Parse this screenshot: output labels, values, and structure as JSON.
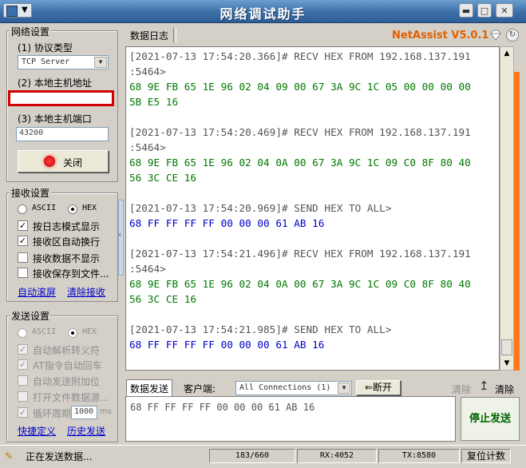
{
  "window": {
    "title": "网络调试助手",
    "brand": "NetAssist V5.0.1",
    "brand_color": "#e06000"
  },
  "net": {
    "group_title": "网络设置",
    "protocol_label": "(1) 协议类型",
    "protocol_value": "TCP Server",
    "host_label": "(2) 本地主机地址",
    "host_value": "",
    "port_label": "(3) 本地主机端口",
    "port_value": "43200",
    "close_button": "关闭"
  },
  "recv": {
    "group_title": "接收设置",
    "ascii": "ASCII",
    "hex": "HEX",
    "opt1": "按日志模式显示",
    "opt2": "接收区自动换行",
    "opt3": "接收数据不显示",
    "opt4": "接收保存到文件...",
    "auto_scroll": "自动滚屏",
    "clear_recv": "清除接收"
  },
  "send": {
    "group_title": "发送设置",
    "ascii": "ASCII",
    "hex": "HEX",
    "opt1": "自动解析转义符",
    "opt2": "AT指令自动回车",
    "opt3": "自动发送附加位",
    "opt4": "打开文件数据源...",
    "opt5_prefix": "循环周期",
    "period_value": "1000",
    "period_unit": "ms",
    "shortcut": "快捷定义",
    "history": "历史发送"
  },
  "log": {
    "tab": "数据日志",
    "lines": [
      {
        "cls": "hdr",
        "text": "[2021-07-13 17:54:20.366]# RECV HEX FROM 192.168.137.191"
      },
      {
        "cls": "hdr",
        "text": ":5464>"
      },
      {
        "cls": "recv",
        "text": "68 9E FB 65 1E 96 02 04 09 00 67 3A 9C 1C 05 00 00 00 00"
      },
      {
        "cls": "recv",
        "text": "5B E5 16"
      },
      {
        "cls": "hdr",
        "text": " "
      },
      {
        "cls": "hdr",
        "text": "[2021-07-13 17:54:20.469]# RECV HEX FROM 192.168.137.191"
      },
      {
        "cls": "hdr",
        "text": ":5464>"
      },
      {
        "cls": "recv",
        "text": "68 9E FB 65 1E 96 02 04 0A 00 67 3A 9C 1C 09 C0 8F 80 40"
      },
      {
        "cls": "recv",
        "text": "56 3C CE 16"
      },
      {
        "cls": "hdr",
        "text": " "
      },
      {
        "cls": "hdr",
        "text": "[2021-07-13 17:54:20.969]# SEND HEX TO ALL>"
      },
      {
        "cls": "send",
        "text": "68 FF FF FF FF 00 00 00 61 AB 16"
      },
      {
        "cls": "hdr",
        "text": " "
      },
      {
        "cls": "hdr",
        "text": "[2021-07-13 17:54:21.496]# RECV HEX FROM 192.168.137.191"
      },
      {
        "cls": "hdr",
        "text": ":5464>"
      },
      {
        "cls": "recv",
        "text": "68 9E FB 65 1E 96 02 04 0A 00 67 3A 9C 1C 09 C0 8F 80 40"
      },
      {
        "cls": "recv",
        "text": "56 3C CE 16"
      },
      {
        "cls": "hdr",
        "text": " "
      },
      {
        "cls": "hdr",
        "text": "[2021-07-13 17:54:21.985]# SEND HEX TO ALL>"
      },
      {
        "cls": "send",
        "text": "68 FF FF FF FF 00 00 00 61 AB 16"
      }
    ]
  },
  "sendbar": {
    "tab": "数据发送",
    "client_label": "客户端:",
    "client_value": "All Connections (1)",
    "disconnect": "断开",
    "clear1": "清除",
    "clear2": "清除",
    "send_text": "68 FF FF FF FF 00 00 00 61 AB 16",
    "stop_button": "停止发送"
  },
  "status": {
    "text": "正在发送数据...",
    "count": "183/660",
    "rx": "RX:4052",
    "tx": "TX:8580",
    "reset": "复位计数"
  }
}
